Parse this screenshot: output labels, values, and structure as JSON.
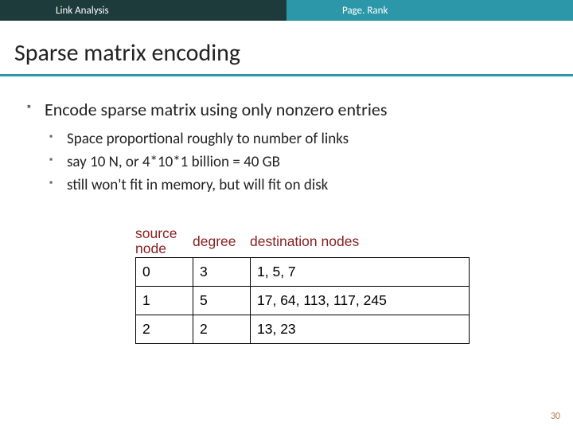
{
  "header": {
    "left": "Link Analysis",
    "right": "Page. Rank"
  },
  "title": "Sparse matrix encoding",
  "bullets": {
    "l1_0": "Encode sparse matrix using only nonzero entries",
    "l2_0": "Space proportional roughly to number of links",
    "l2_1": "say 10 N, or 4*10*1 billion = 40 GB",
    "l2_2": "still won't fit in memory, but will fit on disk"
  },
  "table": {
    "headers": {
      "h1": "source node",
      "h2": "degree",
      "h3": "destination nodes"
    },
    "rows": [
      {
        "src": "0",
        "deg": "3",
        "dest": "1, 5, 7"
      },
      {
        "src": "1",
        "deg": "5",
        "dest": "17, 64, 113, 117, 245"
      },
      {
        "src": "2",
        "deg": "2",
        "dest": "13, 23"
      }
    ]
  },
  "slide_number": "30",
  "chart_data": {
    "type": "table",
    "title": "Sparse matrix encoding",
    "columns": [
      "source node",
      "degree",
      "destination nodes"
    ],
    "rows": [
      [
        0,
        3,
        [
          1,
          5,
          7
        ]
      ],
      [
        1,
        5,
        [
          17,
          64,
          113,
          117,
          245
        ]
      ],
      [
        2,
        2,
        [
          13,
          23
        ]
      ]
    ]
  }
}
